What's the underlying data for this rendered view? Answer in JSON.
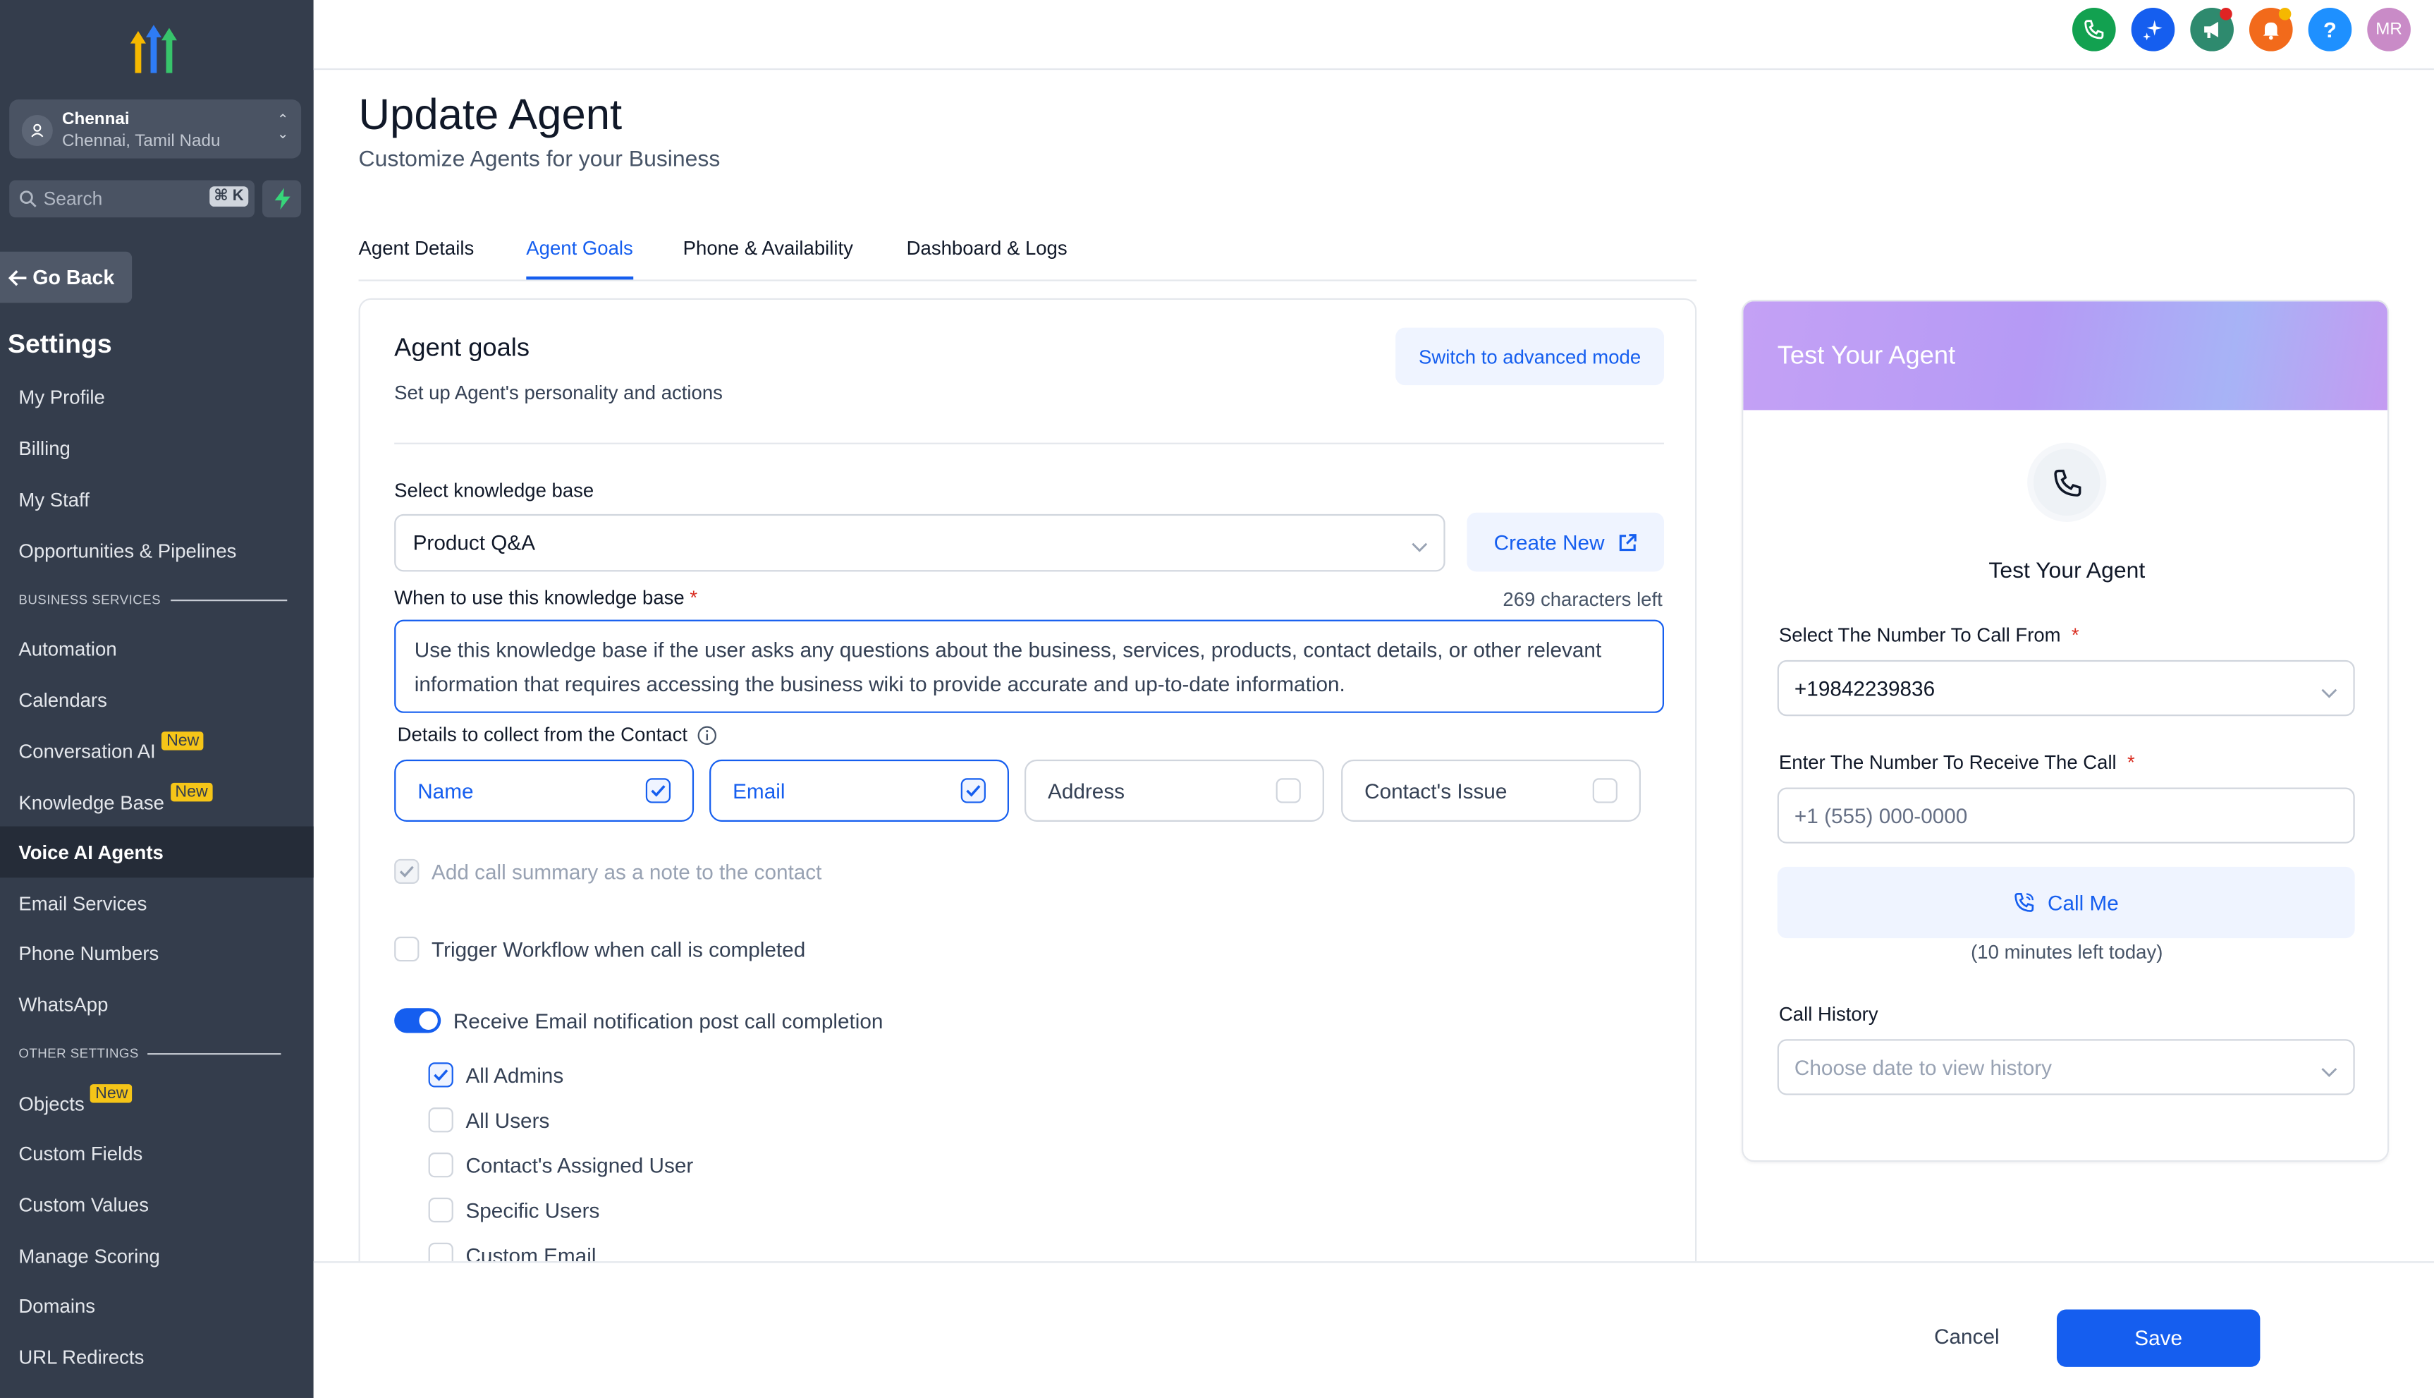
{
  "colors": {
    "primary": "#155eef",
    "sidebar_bg": "#343d4c",
    "badge": "#f5c518"
  },
  "sidebar": {
    "location_name": "Chennai",
    "location_sub": "Chennai, Tamil Nadu",
    "search_placeholder": "Search",
    "search_shortcut": "⌘ K",
    "go_back": "Go Back",
    "settings_title": "Settings",
    "items_top": [
      {
        "label": "My Profile"
      },
      {
        "label": "Billing"
      },
      {
        "label": "My Staff"
      },
      {
        "label": "Opportunities & Pipelines"
      }
    ],
    "section_business": "BUSINESS SERVICES",
    "items_business": [
      {
        "label": "Automation"
      },
      {
        "label": "Calendars"
      },
      {
        "label": "Conversation AI",
        "badge": "New"
      },
      {
        "label": "Knowledge Base",
        "badge": "New"
      },
      {
        "label": "Voice AI Agents",
        "active": true
      },
      {
        "label": "Email Services"
      },
      {
        "label": "Phone Numbers"
      },
      {
        "label": "WhatsApp"
      }
    ],
    "section_other": "OTHER SETTINGS",
    "items_other": [
      {
        "label": "Objects",
        "badge": "New"
      },
      {
        "label": "Custom Fields"
      },
      {
        "label": "Custom Values"
      },
      {
        "label": "Manage Scoring"
      },
      {
        "label": "Domains"
      },
      {
        "label": "URL Redirects"
      }
    ]
  },
  "topbar": {
    "icons": [
      "phone-icon",
      "sparkle-icon",
      "megaphone-icon",
      "bell-icon",
      "help-icon"
    ],
    "avatar_initials": "MR",
    "help_glyph": "?"
  },
  "header": {
    "title": "Update Agent",
    "subtitle": "Customize Agents for your Business",
    "tabs": [
      {
        "label": "Agent Details"
      },
      {
        "label": "Agent Goals",
        "active": true
      },
      {
        "label": "Phone & Availability"
      },
      {
        "label": "Dashboard & Logs"
      }
    ]
  },
  "goals": {
    "title": "Agent goals",
    "subtitle": "Set up Agent's personality and actions",
    "advanced_button": "Switch to advanced mode",
    "kb_label": "Select knowledge base",
    "kb_value": "Product Q&A",
    "create_new": "Create New",
    "when_label": "When to use this knowledge base",
    "required_mark": "*",
    "chars_left": "269 characters left",
    "when_text": "Use this knowledge base if the user asks any questions about the business, services, products, contact details, or other relevant information that requires accessing the business wiki to provide accurate and up-to-date information.",
    "details_label": "Details to collect from the Contact",
    "chips": [
      {
        "label": "Name",
        "checked": true
      },
      {
        "label": "Email",
        "checked": true
      },
      {
        "label": "Address",
        "checked": false
      },
      {
        "label": "Contact's Issue",
        "checked": false
      }
    ],
    "call_summary": "Add call summary as a note to the contact",
    "trigger_workflow": "Trigger Workflow when call is completed",
    "email_notification": "Receive Email notification post call completion",
    "recipients": [
      {
        "label": "All Admins",
        "checked": true
      },
      {
        "label": "All Users",
        "checked": false
      },
      {
        "label": "Contact's Assigned User",
        "checked": false
      },
      {
        "label": "Specific Users",
        "checked": false
      },
      {
        "label": "Custom Email",
        "checked": false
      }
    ]
  },
  "test": {
    "header_title": "Test Your Agent",
    "title": "Test Your Agent",
    "from_label": "Select The Number To Call From",
    "from_value": "+19842239836",
    "to_label": "Enter The Number To Receive The Call",
    "to_placeholder": "+1 (555) 000-0000",
    "call_me": "Call Me",
    "minutes_left": "(10 minutes left today)",
    "history_label": "Call History",
    "history_placeholder": "Choose date to view history",
    "required_mark": "*"
  },
  "footer": {
    "cancel": "Cancel",
    "save": "Save"
  }
}
